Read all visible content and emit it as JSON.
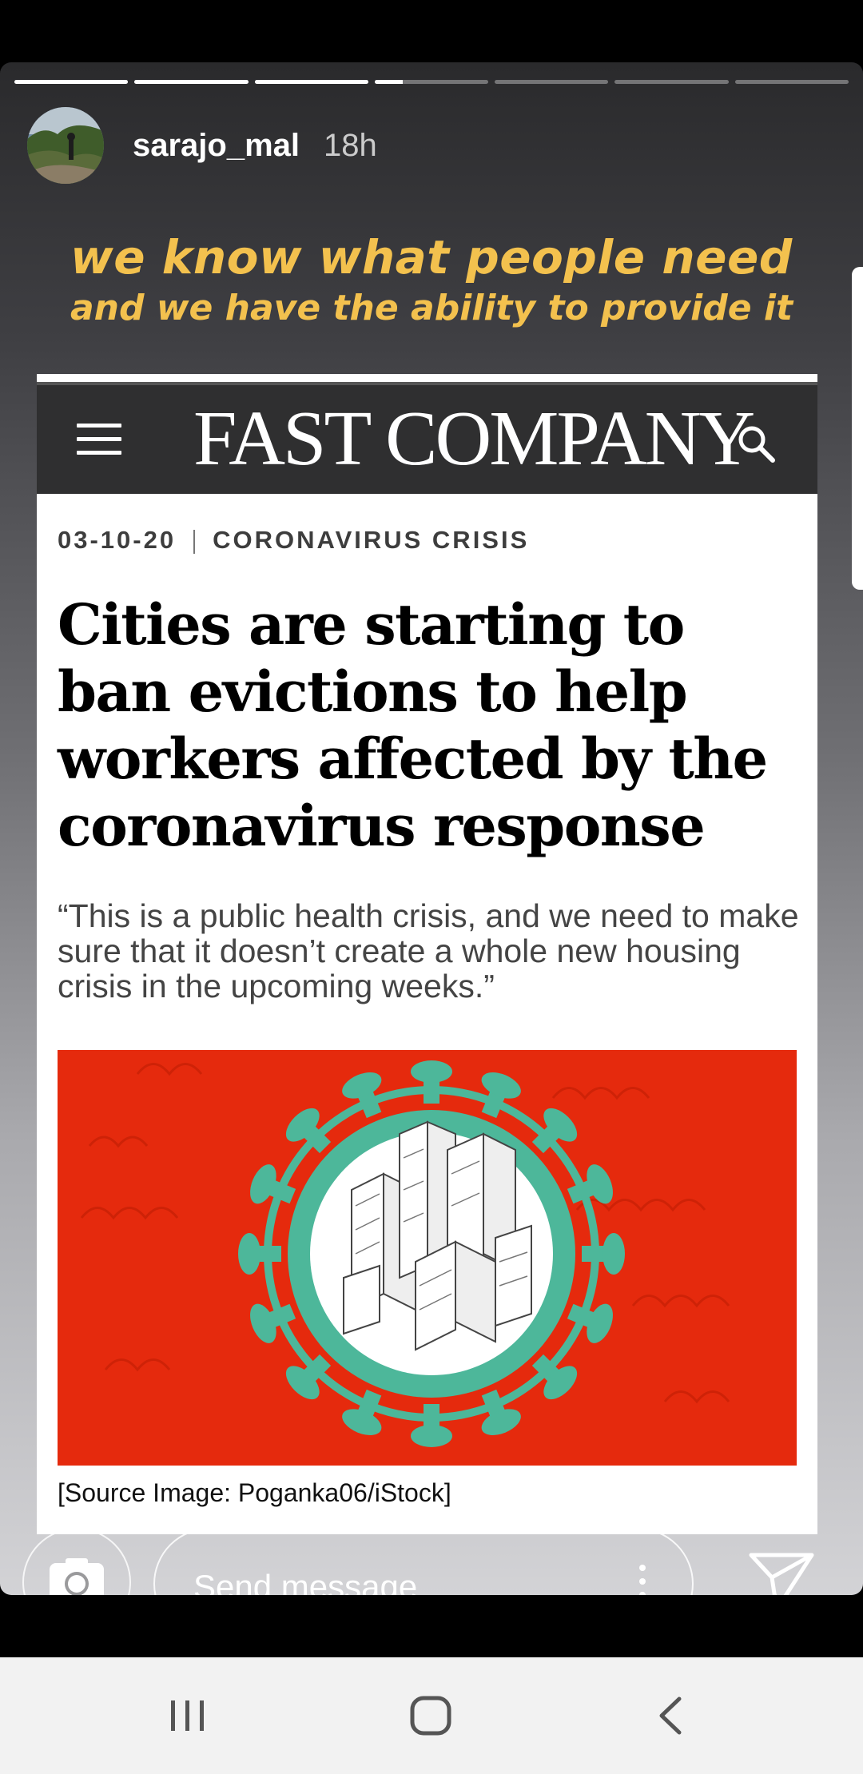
{
  "story": {
    "progress": [
      1,
      1,
      1,
      0.25,
      0,
      0,
      0
    ],
    "username": "sarajo_mal",
    "timestamp": "18h"
  },
  "caption": {
    "line1": "we know what people need",
    "line2": "and we have the ability to provide it"
  },
  "article": {
    "publication": "FAST COMPANY",
    "date": "03-10-20",
    "category": "CORONAVIRUS CRISIS",
    "headline": "Cities are starting to ban evictions to help workers affected by the coronavirus response",
    "dek": "“This is a public health crisis, and we need to make sure that it doesn’t create a whole new housing crisis in the upcoming weeks.”",
    "image_credit": "[Source Image: Poganka06/iStock]"
  },
  "reply": {
    "placeholder": "Send message",
    "camera_icon": "camera-icon",
    "send_icon": "send-icon"
  },
  "colors": {
    "caption": "#f3c14e",
    "art_background": "#e52a0d",
    "virus": "#4db79a"
  }
}
